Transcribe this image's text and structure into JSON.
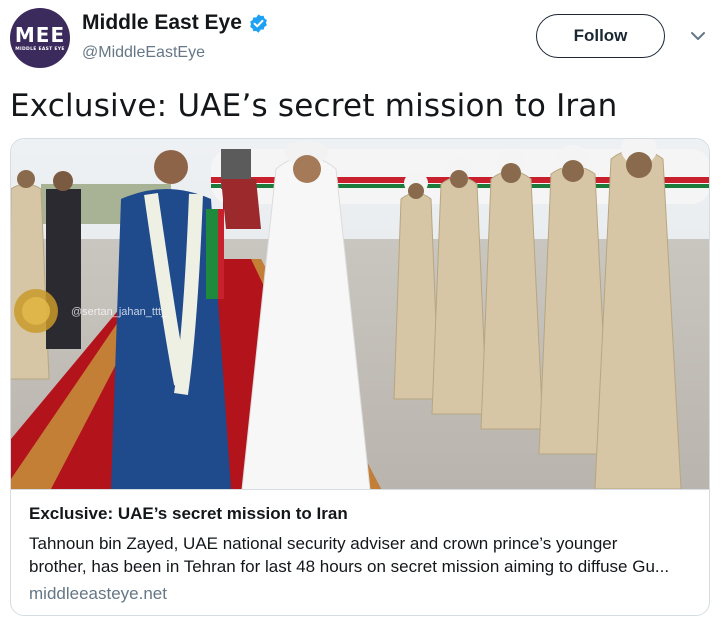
{
  "account": {
    "display_name": "Middle East Eye",
    "handle": "@MiddleEastEye",
    "avatar_logo_text": "MEE",
    "avatar_logo_subtext": "MIDDLE EAST EYE",
    "verified": true
  },
  "follow_label": "Follow",
  "tweet": {
    "text": "Exclusive: UAE’s secret mission to Iran"
  },
  "card": {
    "title": "Exclusive: UAE’s secret mission to Iran",
    "description_line1": "Tahnoun bin Zayed, UAE national security adviser and crown prince’s younger",
    "description_line2": "brother, has been in Tehran for last 48 hours on secret mission aiming to diffuse Gu...",
    "domain": "middleeasteye.net",
    "image_watermark": "@sertan_jahan_ttt_"
  },
  "icons": {
    "verified": "verified-badge-icon",
    "menu": "chevron-down-icon"
  },
  "colors": {
    "verified_blue": "#1da1f2",
    "avatar_purple": "#3b2a5c",
    "carpet_red": "#b3141c"
  }
}
